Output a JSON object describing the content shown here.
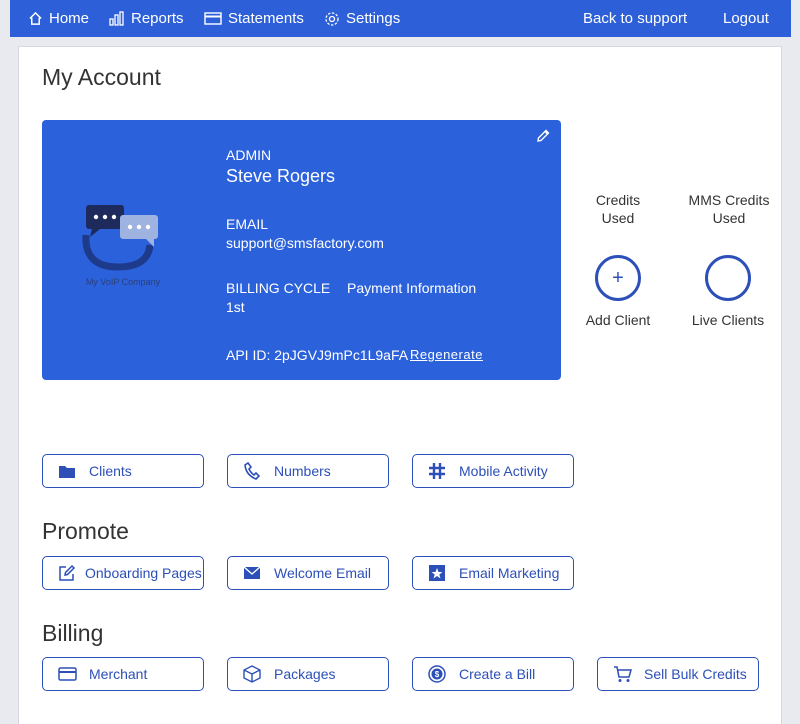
{
  "nav": {
    "home": "Home",
    "reports": "Reports",
    "statements": "Statements",
    "settings": "Settings",
    "back": "Back to support",
    "logout": "Logout"
  },
  "page": {
    "title": "My Account"
  },
  "account": {
    "role": "ADMIN",
    "name": "Steve Rogers",
    "email_label": "EMAIL",
    "email": "support@smsfactory.com",
    "billing_label": "BILLING CYCLE",
    "billing_value": "1st",
    "payment_label": "Payment Information",
    "api_id": "API ID: 2pJGVJ9mPc1L9aFA",
    "regenerate": "Regenerate",
    "logo_text": "My VoIP Company"
  },
  "stats": {
    "credits_line1": "Credits",
    "credits_line2": "Used",
    "mms_line1": "MMS Credits",
    "mms_line2": "Used",
    "add_client": "Add Client",
    "live_clients": "Live Clients",
    "add_symbol": "+"
  },
  "quick": {
    "clients": "Clients",
    "numbers": "Numbers",
    "mobile": "Mobile Activity"
  },
  "promote": {
    "title": "Promote",
    "onboarding": "Onboarding Pages",
    "welcome": "Welcome Email",
    "marketing": "Email Marketing"
  },
  "billing": {
    "title": "Billing",
    "merchant": "Merchant",
    "packages": "Packages",
    "bill": "Create a Bill",
    "bulk": "Sell Bulk Credits"
  },
  "colors": {
    "primary": "#2c61dc",
    "nav": "#2d5fd9",
    "accent": "#2c4fb8"
  }
}
